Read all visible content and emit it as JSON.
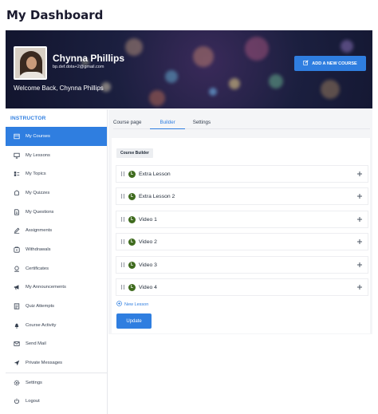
{
  "page": {
    "title": "My Dashboard"
  },
  "profile": {
    "name": "Chynna Phillips",
    "email": "bp.def.dota+2@gmail.com",
    "welcome": "Welcome Back, Chynna Phillips"
  },
  "header_button": {
    "label": "ADD A NEW COURSE",
    "icon": "edit-icon"
  },
  "sidebar": {
    "section_label": "INSTRUCTOR",
    "items": [
      {
        "label": "My Courses",
        "icon": "courses-icon",
        "active": true
      },
      {
        "label": "My Lessons",
        "icon": "monitor-icon"
      },
      {
        "label": "My Topics",
        "icon": "topics-icon"
      },
      {
        "label": "My Quizzes",
        "icon": "puzzle-icon"
      },
      {
        "label": "My Questions",
        "icon": "document-icon"
      },
      {
        "label": "Assignments",
        "icon": "pen-icon"
      },
      {
        "label": "Withdrawals",
        "icon": "wallet-icon"
      },
      {
        "label": "Certificates",
        "icon": "certificate-icon"
      },
      {
        "label": "My Announcements",
        "icon": "megaphone-icon"
      },
      {
        "label": "Quiz Attempts",
        "icon": "attempts-icon"
      },
      {
        "label": "Course Activity",
        "icon": "bell-icon"
      },
      {
        "label": "Send Mail",
        "icon": "mail-icon"
      },
      {
        "label": "Private Messages",
        "icon": "send-icon"
      }
    ],
    "footer_items": [
      {
        "label": "Settings",
        "icon": "gear-icon"
      },
      {
        "label": "Logout",
        "icon": "power-icon"
      }
    ]
  },
  "tabs": [
    {
      "label": "Course page"
    },
    {
      "label": "Builder",
      "active": true
    },
    {
      "label": "Settings"
    }
  ],
  "builder": {
    "label": "Course Builder",
    "lessons": [
      {
        "badge": "L",
        "title": "Extra Lesson"
      },
      {
        "badge": "L",
        "title": "Extra Lesson 2"
      },
      {
        "badge": "L",
        "title": "Video 1"
      },
      {
        "badge": "L",
        "title": "Video 2"
      },
      {
        "badge": "L",
        "title": "Video 3"
      },
      {
        "badge": "L",
        "title": "Video 4"
      }
    ],
    "new_lesson_label": "New Lesson",
    "update_label": "Update"
  },
  "colors": {
    "accent": "#2f7ee0",
    "badge": "#3f6b1e"
  }
}
